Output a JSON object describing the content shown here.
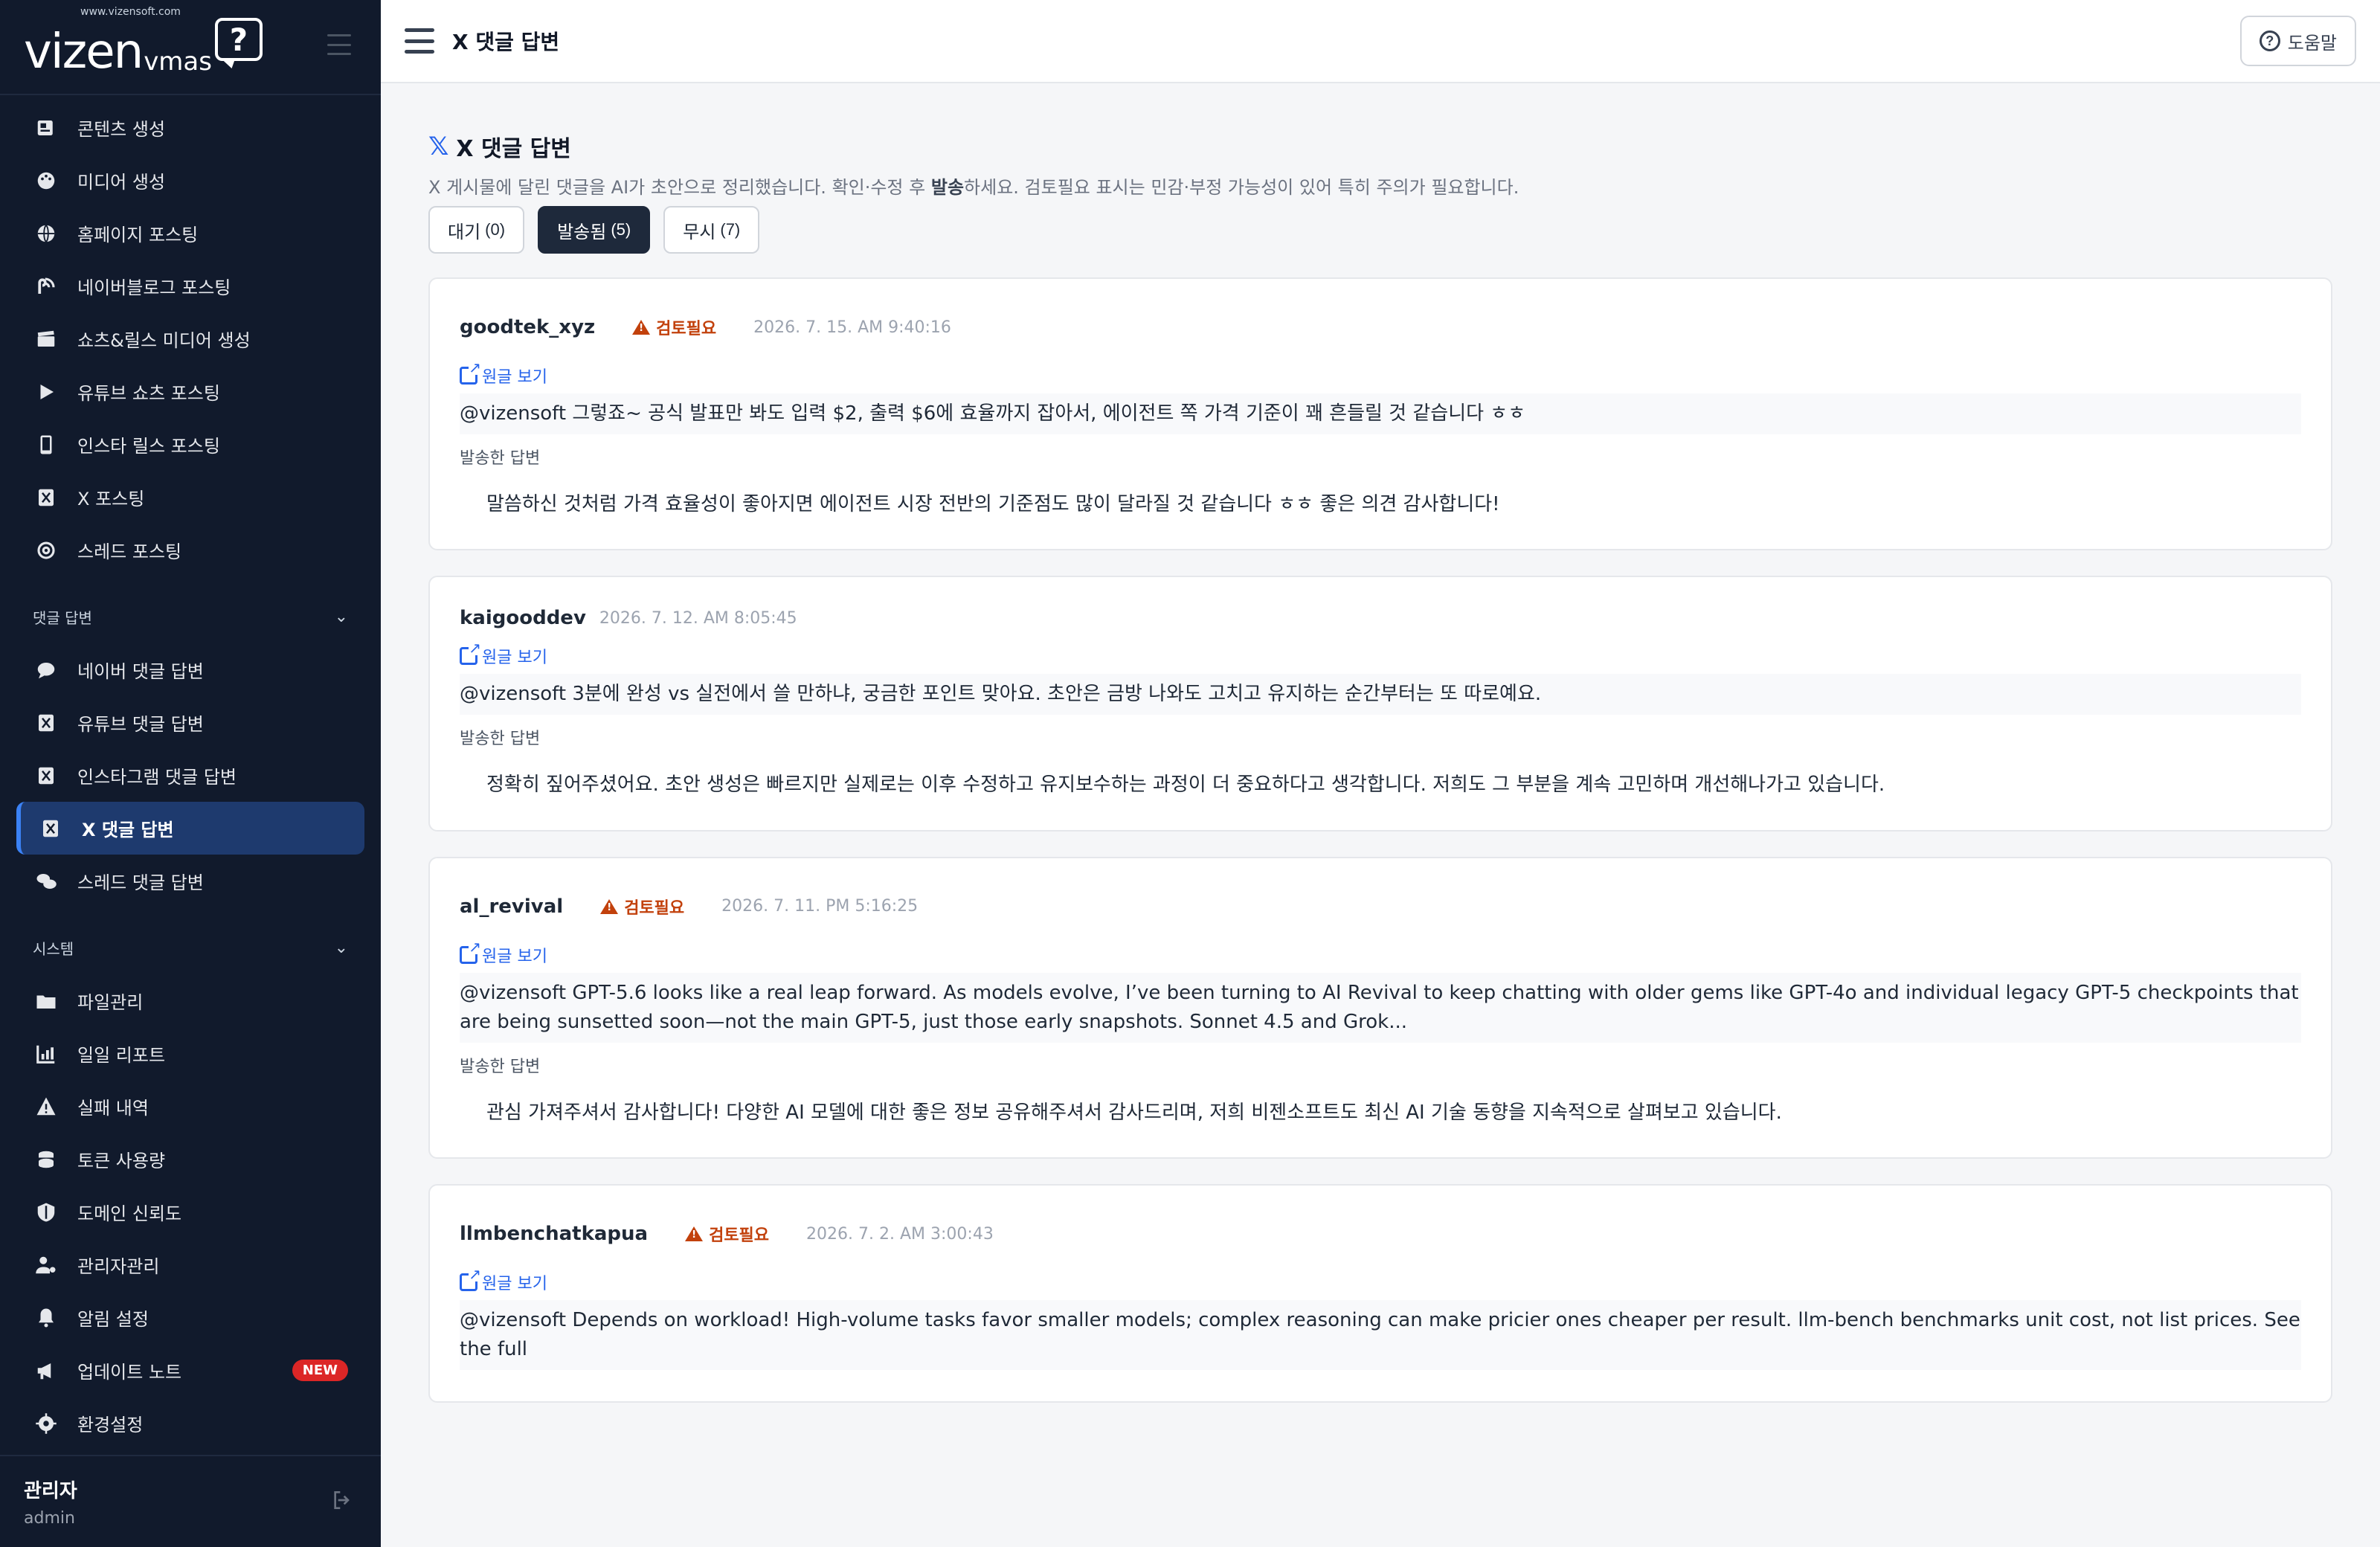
{
  "brand": {
    "logo_main": "vizen",
    "logo_sub": "vmas",
    "logo_url": "www.vizensoft.com",
    "logo_mark": "?"
  },
  "sidebar": {
    "items_top": [
      {
        "label": "콘텐츠 생성",
        "icon": "newspaper-icon"
      },
      {
        "label": "미디어 생성",
        "icon": "palette-icon"
      },
      {
        "label": "홈페이지 포스팅",
        "icon": "globe-icon"
      },
      {
        "label": "네이버블로그 포스팅",
        "icon": "blog-icon"
      },
      {
        "label": "쇼츠&릴스 미디어 생성",
        "icon": "clapper-icon"
      },
      {
        "label": "유튜브 쇼츠 포스팅",
        "icon": "play-icon"
      },
      {
        "label": "인스타 릴스 포스팅",
        "icon": "phone-icon"
      },
      {
        "label": "X 포스팅",
        "icon": "x-icon"
      },
      {
        "label": "스레드 포스팅",
        "icon": "at-icon"
      }
    ],
    "section_reply": "댓글 답변",
    "items_reply": [
      {
        "label": "네이버 댓글 답변",
        "icon": "comment-icon"
      },
      {
        "label": "유튜브 댓글 답변",
        "icon": "x-icon"
      },
      {
        "label": "인스타그램 댓글 답변",
        "icon": "x-icon"
      },
      {
        "label": "X 댓글 답변",
        "icon": "x-icon",
        "active": true
      },
      {
        "label": "스레드 댓글 답변",
        "icon": "comments-icon"
      }
    ],
    "section_system": "시스템",
    "items_system": [
      {
        "label": "파일관리",
        "icon": "folder-icon"
      },
      {
        "label": "일일 리포트",
        "icon": "chart-icon"
      },
      {
        "label": "실패 내역",
        "icon": "warning-icon"
      },
      {
        "label": "토큰 사용량",
        "icon": "coins-icon"
      },
      {
        "label": "도메인 신뢰도",
        "icon": "shield-icon"
      },
      {
        "label": "관리자관리",
        "icon": "user-gear-icon"
      },
      {
        "label": "알림 설정",
        "icon": "bell-icon"
      },
      {
        "label": "업데이트 노트",
        "icon": "megaphone-icon",
        "badge": "NEW"
      },
      {
        "label": "환경설정",
        "icon": "gear-icon"
      }
    ],
    "user_name": "관리자",
    "user_role": "admin"
  },
  "topbar": {
    "title": "X 댓글 답변",
    "help_label": "도움말"
  },
  "main": {
    "title": "X 댓글 답변",
    "title_mark": "𝕏",
    "description_pre": "X 게시물에 달린 댓글을 AI가 초안으로 정리했습니다. 확인·수정 후 ",
    "description_bold": "발송",
    "description_post": "하세요. 검토필요 표시는 민감·부정 가능성이 있어 특히 주의가 필요합니다.",
    "tabs": [
      {
        "label": "대기",
        "count": "(0)"
      },
      {
        "label": "발송됨",
        "count": "(5)",
        "active": true
      },
      {
        "label": "무시",
        "count": "(7)"
      }
    ],
    "original_link_label": "원글 보기",
    "reply_label": "발송한 답변",
    "review_label": "검토필요",
    "cards": [
      {
        "author": "goodtek_xyz",
        "review": true,
        "date": "2026. 7. 15. AM 9:40:16",
        "comment": "@vizensoft 그렇죠~ 공식 발표만 봐도 입력 $2, 출력 $6에 효율까지 잡아서, 에이전트 쪽 가격 기준이 꽤 흔들릴 것 같습니다 ㅎㅎ",
        "reply": "말씀하신 것처럼 가격 효율성이 좋아지면 에이전트 시장 전반의 기준점도 많이 달라질 것 같습니다 ㅎㅎ 좋은 의견 감사합니다!"
      },
      {
        "author": "kaigooddev",
        "review": false,
        "date": "2026. 7. 12. AM 8:05:45",
        "comment": "@vizensoft 3분에 완성 vs 실전에서 쓸 만하냐, 궁금한 포인트 맞아요. 초안은 금방 나와도 고치고 유지하는 순간부터는 또 따로예요.",
        "reply": "정확히 짚어주셨어요. 초안 생성은 빠르지만 실제로는 이후 수정하고 유지보수하는 과정이 더 중요하다고 생각합니다. 저희도 그 부분을 계속 고민하며 개선해나가고 있습니다."
      },
      {
        "author": "al_revival",
        "review": true,
        "date": "2026. 7. 11. PM 5:16:25",
        "comment": "@vizensoft GPT-5.6 looks like a real leap forward. As models evolve, I’ve been turning to AI Revival to keep chatting with older gems like GPT-4o and individual legacy GPT-5 checkpoints that are being sunsetted soon—not the main GPT-5, just those early snapshots. Sonnet 4.5 and Grok...",
        "reply": "관심 가져주셔서 감사합니다! 다양한 AI 모델에 대한 좋은 정보 공유해주셔서 감사드리며, 저희 비젠소프트도 최신 AI 기술 동향을 지속적으로 살펴보고 있습니다."
      },
      {
        "author": "llmbenchatkapua",
        "review": true,
        "date": "2026. 7. 2. AM 3:00:43",
        "comment": "@vizensoft Depends on workload! High-volume tasks favor smaller models; complex reasoning can make pricier ones cheaper per result. llm-bench benchmarks unit cost, not list prices. See the full",
        "reply": ""
      }
    ]
  },
  "colors": {
    "sidebar_bg": "#111a2c",
    "active_bg": "#1e3a6e",
    "accent": "#2563eb",
    "warning": "#c2410c",
    "badge_new": "#dc2626"
  }
}
